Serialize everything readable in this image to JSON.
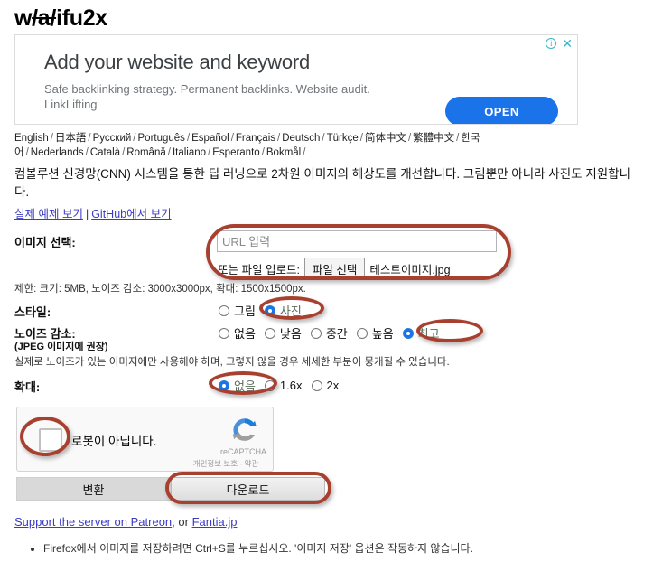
{
  "site": {
    "title_pre": "w",
    "title_strike": "/a/",
    "title_post": "ifu2x"
  },
  "ad": {
    "headline": "Add your website and keyword",
    "description": "Safe backlinking strategy. Permanent backlinks. Website audit. LinkLifting",
    "open_label": "OPEN",
    "info_icon": "i",
    "close_icon": "✕",
    "button_color": "#1a73e8"
  },
  "languages": [
    "English",
    "日本語",
    "Русский",
    "Português",
    "Español",
    "Français",
    "Deutsch",
    "Türkçe",
    "简体中文",
    "繁體中文",
    "한국어",
    "Nederlands",
    "Català",
    "Română",
    "Italiano",
    "Esperanto",
    "Bokmål"
  ],
  "description": "컴볼루션 신경망(CNN) 시스템을 통한 딥 러닝으로 2차원 이미지의 해상도를 개선합니다. 그림뿐만 아니라 사진도 지원합니다.",
  "top_links": {
    "example": "실제 예제 보기",
    "separator": "|",
    "github": "GitHub에서 보기"
  },
  "form": {
    "image_select_label": "이미지 선택:",
    "url_placeholder": "URL 입력",
    "url_value": "",
    "upload_label": "또는 파일 업로드:",
    "file_button": "파일 선택",
    "file_name": "테스트이미지.jpg",
    "limits": "제한: 크기: 5MB, 노이즈 감소: 3000x3000px, 확대: 1500x1500px.",
    "style": {
      "label": "스타일:",
      "options": [
        {
          "label": "그림",
          "selected": false
        },
        {
          "label": "사진",
          "selected": true
        }
      ]
    },
    "noise": {
      "label": "노이즈 감소:",
      "sublabel": "(JPEG 이미지에 권장)",
      "options": [
        {
          "label": "없음",
          "selected": false
        },
        {
          "label": "낮음",
          "selected": false
        },
        {
          "label": "중간",
          "selected": false
        },
        {
          "label": "높음",
          "selected": false
        },
        {
          "label": "최고",
          "selected": true
        }
      ]
    },
    "noise_note": "실제로 노이즈가 있는 이미지에만 사용해야 하며, 그렇지 않을 경우 세세한 부분이 뭉개질 수 있습니다.",
    "scale": {
      "label": "확대:",
      "options": [
        {
          "label": "없음",
          "selected": true
        },
        {
          "label": "1.6x",
          "selected": false
        },
        {
          "label": "2x",
          "selected": false
        }
      ]
    }
  },
  "recaptcha": {
    "text": "로봇이 아닙니다.",
    "checked": false,
    "brand": "reCAPTCHA",
    "terms": "개인정보 보호 - 약관"
  },
  "buttons": {
    "convert": "변환",
    "download": "다운로드"
  },
  "footer": {
    "support_link": "Support the server on Patreon",
    "support_mid": ", or ",
    "support_link2": "Fantia.jp",
    "note": "Firefox에서 이미지를 저장하려면 Ctrl+S를 누르십시오. '이미지 저장' 옵션은 작동하지 않습니다."
  },
  "annotation_color": "#a8402f"
}
